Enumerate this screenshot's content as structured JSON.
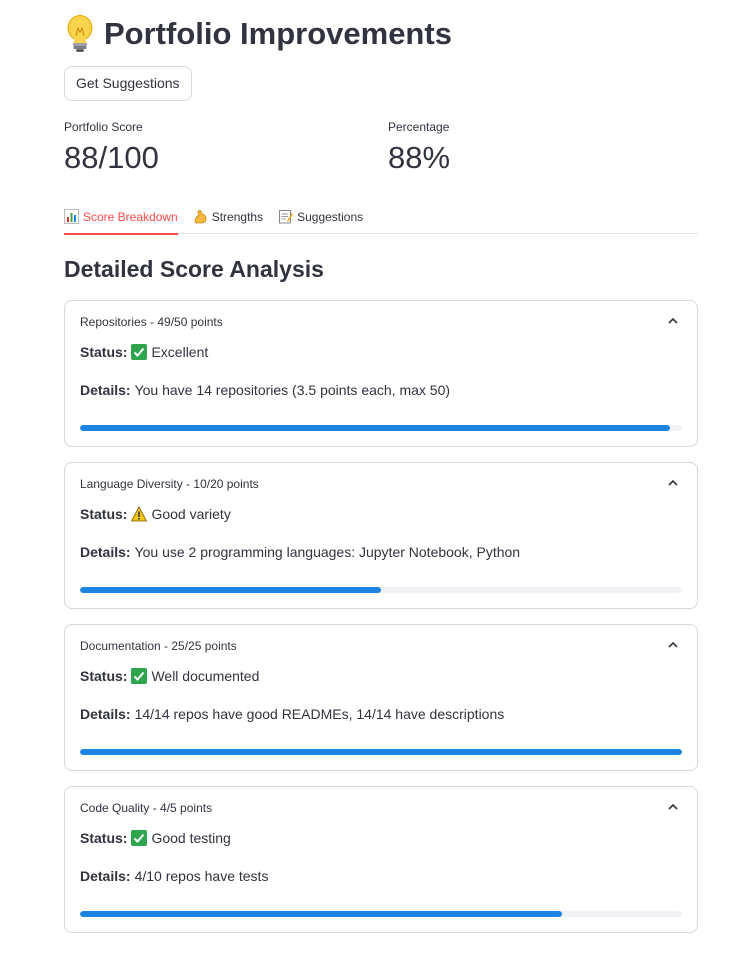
{
  "header": {
    "title": "Portfolio Improvements",
    "title_icon": "lightbulb-icon"
  },
  "actions": {
    "get_suggestions_label": "Get Suggestions"
  },
  "metrics": [
    {
      "label": "Portfolio Score",
      "value": "88/100"
    },
    {
      "label": "Percentage",
      "value": "88%"
    }
  ],
  "tabs": [
    {
      "label": "Score Breakdown",
      "icon": "bar-chart-icon",
      "active": true
    },
    {
      "label": "Strengths",
      "icon": "flexed-biceps-icon",
      "active": false
    },
    {
      "label": "Suggestions",
      "icon": "memo-icon",
      "active": false
    }
  ],
  "section": {
    "title": "Detailed Score Analysis"
  },
  "labels": {
    "status": "Status:",
    "details": "Details:"
  },
  "cards": [
    {
      "header": "Repositories - 49/50 points",
      "status_icon": "check-mark-icon",
      "status": "Excellent",
      "details": "You have 14 repositories (3.5 points each, max 50)",
      "progress": 0.98
    },
    {
      "header": "Language Diversity - 10/20 points",
      "status_icon": "warning-icon",
      "status": "Good variety",
      "details": "You use 2 programming languages: Jupyter Notebook, Python",
      "progress": 0.5
    },
    {
      "header": "Documentation - 25/25 points",
      "status_icon": "check-mark-icon",
      "status": "Well documented",
      "details": "14/14 repos have good READMEs, 14/14 have descriptions",
      "progress": 1.0
    },
    {
      "header": "Code Quality - 4/5 points",
      "status_icon": "check-mark-icon",
      "status": "Good testing",
      "details": "4/10 repos have tests",
      "progress": 0.8
    }
  ],
  "colors": {
    "accent": "#ff4b4b",
    "progress": "#1c83e1",
    "check": "#2ea44f",
    "warning": "#f5c518"
  }
}
